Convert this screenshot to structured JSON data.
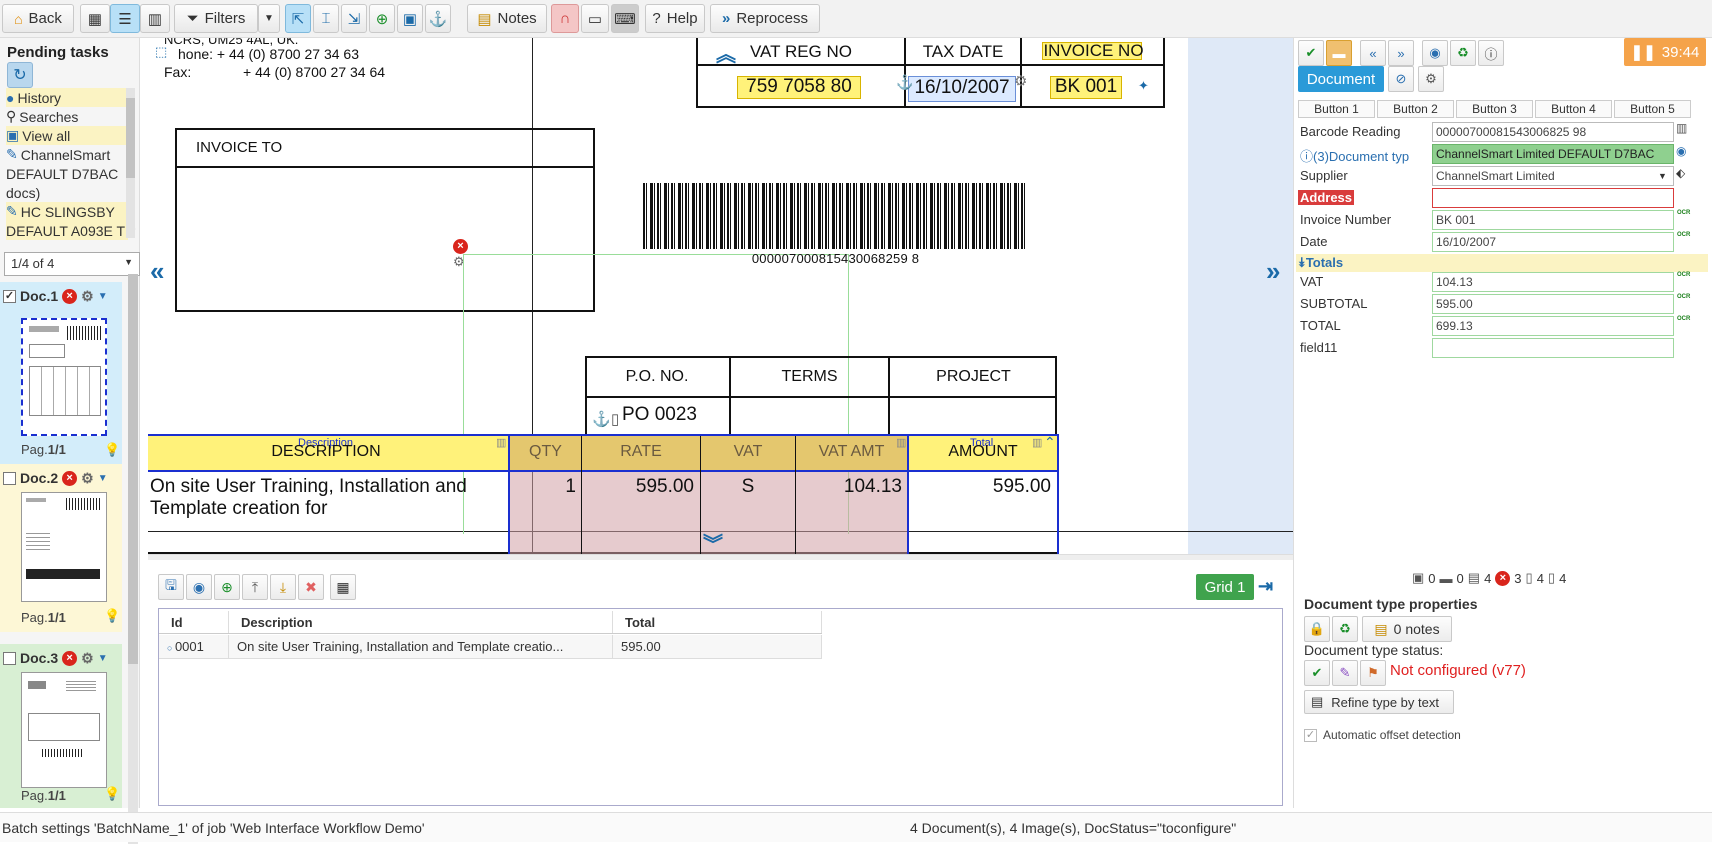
{
  "toolbar": {
    "back_label": "Back",
    "filters_label": "Filters",
    "notes_label": "Notes",
    "help_label": "Help",
    "reprocess_label": "Reprocess"
  },
  "left": {
    "title": "Pending tasks",
    "nav": [
      "History",
      "Searches",
      "View all"
    ],
    "batches": [
      "ChannelSmart",
      "DEFAULT D7BAC",
      "docs)",
      "HC SLINGSBY",
      "DEFAULT A093E T"
    ],
    "page_select": "1/4 of 4",
    "docs": [
      {
        "label": "Doc.",
        "num": "1",
        "pag": "Pag.",
        "pag_num": "1/1"
      },
      {
        "label": "Doc.",
        "num": "2",
        "pag": "Pag.",
        "pag_num": "1/1"
      },
      {
        "label": "Doc.",
        "num": "3",
        "pag": "Pag.",
        "pag_num": "1/1"
      }
    ]
  },
  "viewer": {
    "header_text": "hone:   + 44 (0) 8700 27 34 63",
    "header_cut": "NCRS, UM25 4AL, UK.",
    "fax_label": "Fax:",
    "fax_value": "+ 44 (0) 8700 27 34 64",
    "vat_reg_header": "VAT REG NO",
    "tax_date_header": "TAX DATE",
    "invoice_no_header": "INVOICE NO",
    "vat_reg_value": "759 7058 80",
    "tax_date_value": "16/10/2007",
    "invoice_no_value": "BK 001",
    "invoice_to": "INVOICE TO",
    "barcode_number": "000007000815430068259 8",
    "po_header": "P.O. NO.",
    "terms_header": "TERMS",
    "project_header": "PROJECT",
    "po_value": "PO 0023",
    "line_headers": [
      "DESCRIPTION",
      "QTY",
      "RATE",
      "VAT",
      "VAT AMT",
      "AMOUNT"
    ],
    "desc_tag": "Description",
    "total_tag": "Total",
    "row_desc_1": "On site User Training, Installation and",
    "row_desc_2": "Template creation for",
    "row_qty": "1",
    "row_rate": "595.00",
    "row_vat": "S",
    "row_vatamt": "104.13",
    "row_amount": "595.00"
  },
  "grid": {
    "label": "Grid 1",
    "headers": [
      "Id",
      "Description",
      "Total"
    ],
    "rows": [
      {
        "id": "0001",
        "description": "On site User Training, Installation and Template creatio...",
        "total": "595.00"
      }
    ]
  },
  "right": {
    "timer": "39:44",
    "document_tab": "Document",
    "buttons": [
      "Button 1",
      "Button 2",
      "Button 3",
      "Button 4",
      "Button 5"
    ],
    "fields": [
      {
        "label": "Barcode Reading",
        "value": "00000700081543006825 98"
      },
      {
        "label": "(3)Document typ",
        "value": "ChannelSmart Limited DEFAULT D7BAC"
      },
      {
        "label": "Supplier",
        "value": "ChannelSmart Limited"
      },
      {
        "label": "Address",
        "value": ""
      },
      {
        "label": "Invoice Number",
        "value": "BK 001"
      },
      {
        "label": "Date",
        "value": "16/10/2007"
      }
    ],
    "totals_label": "Totals",
    "totals": [
      {
        "label": "VAT",
        "value": "104.13"
      },
      {
        "label": "SUBTOTAL",
        "value": "595.00"
      },
      {
        "label": "TOTAL",
        "value": "699.13"
      },
      {
        "label": "field11",
        "value": ""
      }
    ],
    "ocr_label": "OCR",
    "counters": [
      "0",
      "0",
      "4",
      "3",
      "4",
      "4"
    ],
    "props_title": "Document type properties",
    "notes_count": "0 notes",
    "status_title": "Document type status:",
    "status_value": "Not configured (v77)",
    "refine_label": "Refine type by text",
    "auto_offset": "Automatic offset detection"
  },
  "status": {
    "left": "Batch settings 'BatchName_1' of job 'Web Interface Workflow Demo'",
    "right": "4 Document(s), 4 Image(s), DocStatus=\"toconfigure\""
  }
}
